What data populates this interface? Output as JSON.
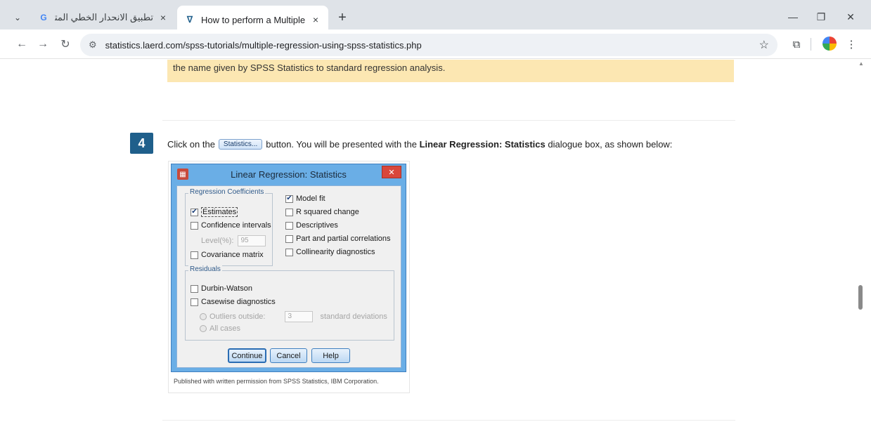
{
  "browser": {
    "tabs": [
      {
        "title": "تطبيق الانحدار الخطي المتعدد في",
        "favicon": "G",
        "active": false
      },
      {
        "title": "How to perform a Multiple Reg",
        "favicon": "laerd-icon",
        "active": true
      }
    ],
    "url": "statistics.laerd.com/spss-tutorials/multiple-regression-using-spss-statistics.php"
  },
  "page": {
    "note_text": "the name given by SPSS Statistics to standard regression analysis.",
    "step": {
      "number": "4",
      "text_before": "Click on the",
      "button_label": "Statistics...",
      "text_after": "button. You will be presented with the",
      "bold_text": "Linear Regression: Statistics",
      "text_end": "dialogue box, as shown below:"
    },
    "caption": "Published with written permission from SPSS Statistics, IBM Corporation."
  },
  "dialog": {
    "title": "Linear Regression: Statistics",
    "coef_group_label": "Regression Coefficients",
    "estimates": "Estimates",
    "confidence_intervals": "Confidence intervals",
    "level_label": "Level(%):",
    "level_value": "95",
    "covariance_matrix": "Covariance matrix",
    "model_fit": "Model fit",
    "r_squared_change": "R squared change",
    "descriptives": "Descriptives",
    "part_partial": "Part and partial correlations",
    "collinearity": "Collinearity diagnostics",
    "residuals_group_label": "Residuals",
    "durbin_watson": "Durbin-Watson",
    "casewise": "Casewise diagnostics",
    "outliers_outside": "Outliers outside:",
    "outliers_value": "3",
    "std_dev": "standard deviations",
    "all_cases": "All cases",
    "btn_continue": "Continue",
    "btn_cancel": "Cancel",
    "btn_help": "Help",
    "checked": {
      "estimates": true,
      "model_fit": true
    }
  }
}
